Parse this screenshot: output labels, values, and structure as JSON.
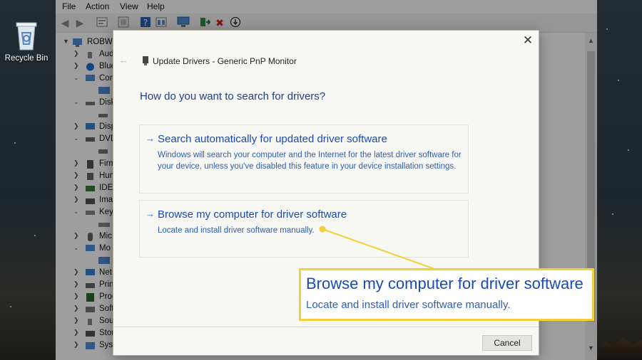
{
  "desktop": {
    "recycle_bin_label": "Recycle Bin"
  },
  "device_manager": {
    "menu": [
      "File",
      "Action",
      "View",
      "Help"
    ],
    "root_label": "ROBWI",
    "tree": [
      {
        "label": "Aud",
        "expanded": false
      },
      {
        "label": "Blue",
        "expanded": false
      },
      {
        "label": "Com",
        "expanded": true
      },
      {
        "label": "",
        "child": true
      },
      {
        "label": "Disk",
        "expanded": true
      },
      {
        "label": "",
        "child": true
      },
      {
        "label": "Disp",
        "expanded": false
      },
      {
        "label": "DVD",
        "expanded": true
      },
      {
        "label": "",
        "child": true
      },
      {
        "label": "Firm",
        "expanded": false
      },
      {
        "label": "Hum",
        "expanded": false
      },
      {
        "label": "IDE",
        "expanded": false
      },
      {
        "label": "Ima",
        "expanded": false
      },
      {
        "label": "Key",
        "expanded": true
      },
      {
        "label": "",
        "child": true
      },
      {
        "label": "Mic",
        "expanded": false
      },
      {
        "label": "Mo",
        "expanded": true
      },
      {
        "label": "",
        "child": true
      },
      {
        "label": "Net",
        "expanded": false
      },
      {
        "label": "Prin",
        "expanded": false
      },
      {
        "label": "Proc",
        "expanded": false
      },
      {
        "label": "Soft",
        "expanded": false
      },
      {
        "label": "Sou",
        "expanded": false
      },
      {
        "label": "Stor",
        "expanded": false
      },
      {
        "label": "Syst",
        "expanded": false
      }
    ]
  },
  "dialog": {
    "title": "Update Drivers - Generic PnP Monitor",
    "heading": "How do you want to search for drivers?",
    "option_auto": {
      "title": "Search automatically for updated driver software",
      "description": "Windows will search your computer and the Internet for the latest driver software for your device, unless you've disabled this feature in your device installation settings."
    },
    "option_browse": {
      "title": "Browse my computer for driver software",
      "description": "Locate and install driver software manually."
    },
    "cancel_label": "Cancel"
  },
  "callout": {
    "title": "Browse my computer for driver software",
    "description": "Locate and install driver software manually."
  },
  "colors": {
    "link_blue": "#1a4bb4",
    "heading_blue": "#1e3f87",
    "callout_border": "#f2d03b",
    "error_red": "#d42020"
  },
  "icons": [
    "recycle-bin-icon",
    "back-icon",
    "forward-icon",
    "properties-icon",
    "help-icon",
    "scan-icon",
    "update-driver-icon",
    "uninstall-icon",
    "disable-icon",
    "close-icon",
    "monitor-icon"
  ]
}
